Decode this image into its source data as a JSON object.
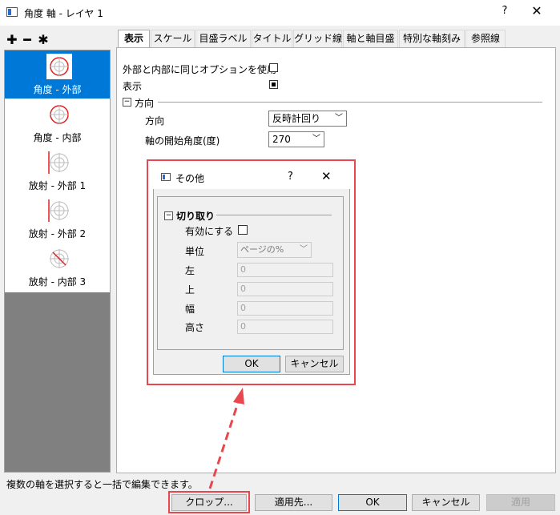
{
  "window": {
    "title": "角度 軸 - レイヤ 1",
    "help": "?",
    "close": "✕"
  },
  "toolbar": {
    "add": "✚",
    "remove": "━",
    "settings": "✱"
  },
  "left_list": {
    "items": [
      {
        "label": "角度 - 外部",
        "icon": "angle-outer-icon",
        "selected": true
      },
      {
        "label": "角度 - 内部",
        "icon": "angle-inner-icon"
      },
      {
        "label": "放射 - 外部 1",
        "icon": "radial-outer-1-icon"
      },
      {
        "label": "放射 - 外部 2",
        "icon": "radial-outer-2-icon"
      },
      {
        "label": "放射 - 内部 3",
        "icon": "radial-inner-3-icon"
      }
    ]
  },
  "tabs": [
    "表示",
    "スケール",
    "目盛ラベル",
    "タイトル",
    "グリッド線",
    "軸と軸目盛",
    "特別な軸刻み",
    "参照線"
  ],
  "display": {
    "same_option_label": "外部と内部に同じオプションを使用",
    "show_label": "表示",
    "direction_group": "方向",
    "direction_label": "方向",
    "direction_value": "反時計回り",
    "start_angle_label": "軸の開始角度(度)",
    "start_angle_value": "270"
  },
  "sub_dialog": {
    "title": "その他",
    "help": "?",
    "close": "✕",
    "group": "切り取り",
    "enable_label": "有効にする",
    "unit_label": "単位",
    "unit_value": "ページの%",
    "left_label": "左",
    "left_value": "0",
    "top_label": "上",
    "top_value": "0",
    "width_label": "幅",
    "width_value": "0",
    "height_label": "高さ",
    "height_value": "0",
    "ok": "OK",
    "cancel": "キャンセル"
  },
  "status_text": "複数の軸を選択すると一括で編集できます。",
  "buttons": {
    "crop": "クロップ...",
    "apply_to": "適用先...",
    "ok": "OK",
    "cancel": "キャンセル",
    "apply": "適用"
  },
  "colors": {
    "accent": "#0078d7",
    "highlight": "#e8474f",
    "icon_red": "#e02020"
  }
}
